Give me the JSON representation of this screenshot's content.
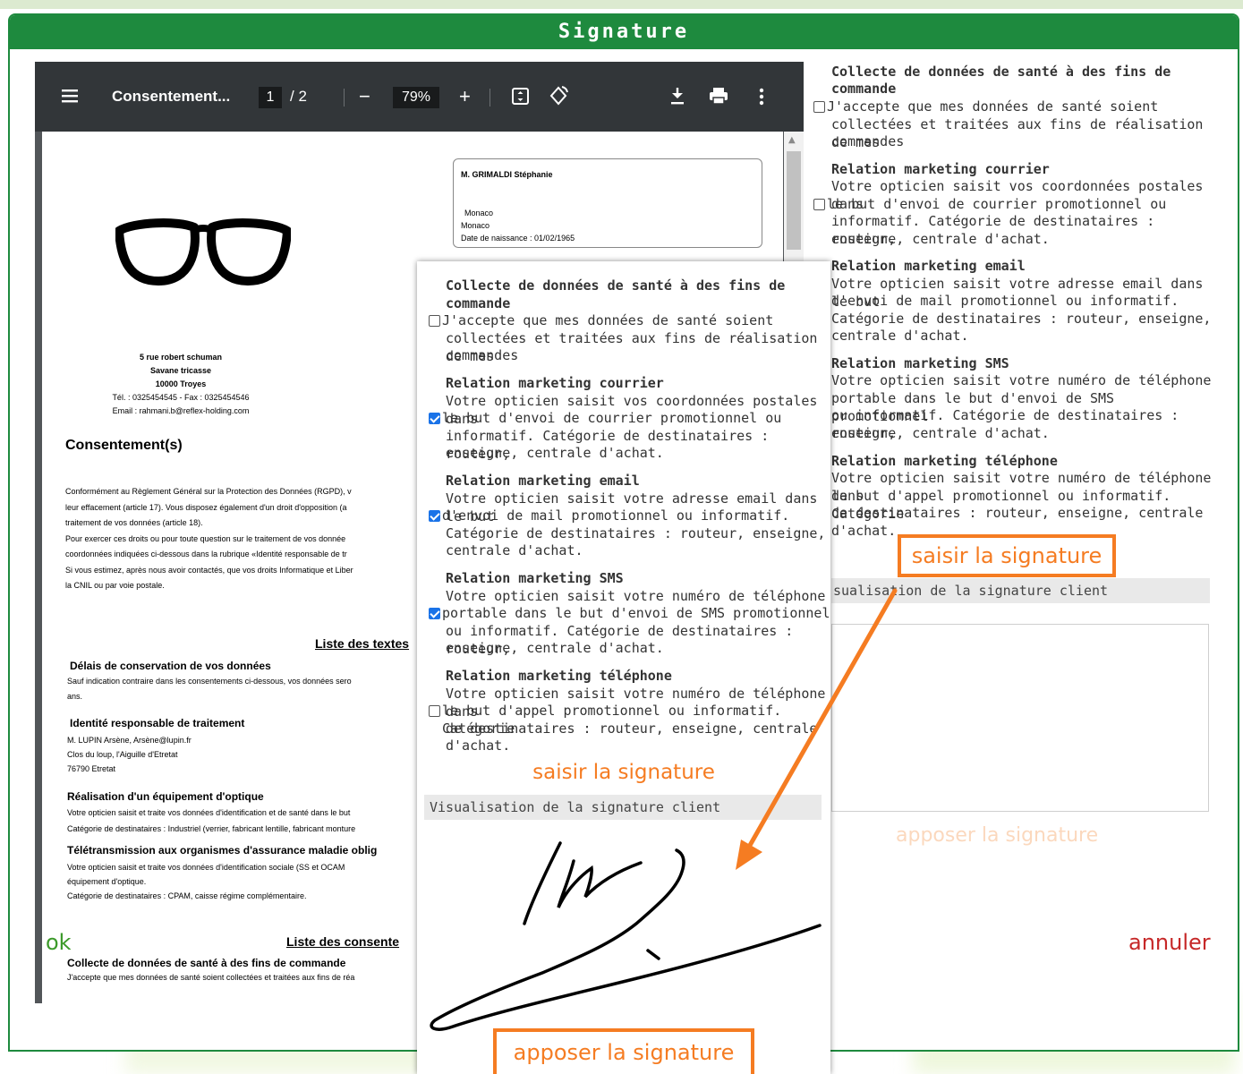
{
  "dialog": {
    "title": "Signature",
    "ok_label": "ok",
    "cancel_label": "annuler"
  },
  "pdf": {
    "toolbar": {
      "menu_icon": "hamburger-icon",
      "doc_title": "Consentement...",
      "page_current": "1",
      "page_total": "/ 2",
      "zoom_out": "−",
      "zoom": "79%",
      "zoom_in": "+",
      "fit_icon": "fit-page-icon",
      "rotate_icon": "rotate-icon",
      "download_icon": "download-icon",
      "print_icon": "print-icon",
      "more_icon": "more-vert-icon"
    },
    "patient": {
      "name": "M. GRIMALDI Stéphanie",
      "city1": "Monaco",
      "city2": "Monaco",
      "birth": "Date de naissance : 01/02/1965"
    },
    "address": {
      "line1": "5 rue robert schuman",
      "line2": "Savane tricasse",
      "line3": "10000 Troyes",
      "phone": "Tél. : 0325454545 - Fax : 0325454546",
      "email": "Email : rahmani.b@reflex-holding.com"
    },
    "consent_heading": "Consentement(s)",
    "body": [
      "Conformément au Règlement Général sur la Protection des Données (RGPD), v",
      "leur effacement (article 17). Vous disposez également d'un droit d'opposition (a",
      "traitement de vos données (article 18).",
      "Pour exercer ces droits ou pour toute question sur le traitement de vos donnée",
      "coordonnées indiquées ci-dessous dans la rubrique «Identité responsable de tr",
      "Si vous estimez, après nous avoir contactés, que vos droits Informatique et Liber",
      "la CNIL ou par voie postale."
    ],
    "list_texts": "Liste des textes",
    "delais_title": "Délais de conservation de vos données",
    "delais_body1": "Sauf indication contraire dans les consentements ci-dessous, vos données sero",
    "delais_body2": "ans.",
    "identite_title": "Identité responsable de traitement",
    "identite_lines": [
      "M. LUPIN Arsène, Arsène@lupin.fr",
      "Clos du loup, l'Aiguille d'Etretat",
      "76790 Etretat"
    ],
    "realisation_title": "Réalisation d'un équipement d'optique",
    "realisation_lines": [
      "Votre opticien saisit et traite vos données d'identification et de santé dans le but",
      "Catégorie de destinataires : Industriel (verrier, fabricant lentille, fabricant monture"
    ],
    "teletrans_title": "Télétransmission aux organismes d'assurance maladie oblig",
    "teletrans_lines": [
      "Votre opticien saisit et traite vos données d'identification sociale (SS et OCAM",
      "équipement d'optique.",
      "Catégorie de destinataires : CPAM, caisse régime complémentaire."
    ],
    "list_consents": "Liste des consente",
    "collecte_title": "Collecte de données de santé à des fins de commande",
    "collecte_body": "J'accepte que mes données de santé soient collectées et traitées aux fins de réa"
  },
  "right": {
    "s1_title1": "Collecte de données de santé à des fins de",
    "s1_title2": "commande",
    "s1_l1": "J'accepte que mes données de santé soient",
    "s1_l2": "collectées et traitées aux fins de réalisation de mes",
    "s1_l3": "commandes",
    "s2_title": "Relation marketing courrier",
    "s2_l1": "Votre opticien saisit vos coordonnées postales dans",
    "s2_l2": "le but d'envoi de courrier promotionnel ou",
    "s2_l3": "informatif. Catégorie de destinataires : routeur,",
    "s2_l4": "enseigne, centrale d'achat.",
    "s3_title": "Relation marketing email",
    "s3_l1": "Votre opticien saisit votre adresse email dans le but",
    "s3_l2": "d'envoi de mail promotionnel ou informatif.",
    "s3_l3": "Catégorie de destinataires : routeur, enseigne,",
    "s3_l4": "centrale d'achat.",
    "s4_title": "Relation marketing SMS",
    "s4_l1": "Votre opticien saisit votre numéro de téléphone",
    "s4_l2": "portable dans le but d'envoi de SMS promotionnel",
    "s4_l3": "ou informatif. Catégorie de destinataires : routeur,",
    "s4_l4": "enseigne, centrale d'achat.",
    "s5_title": "Relation marketing téléphone",
    "s5_l1": "Votre opticien saisit votre numéro de téléphone dans",
    "s5_l2": "le but d'appel promotionnel ou informatif. Catégorie",
    "s5_l3": "de destinataires : routeur, enseigne, centrale",
    "s5_l4": "d'achat.",
    "saisir": "saisir la signature",
    "vis_label": "sualisation de la signature client",
    "apposer": "apposer la signature"
  },
  "popup": {
    "s1_title1": "Collecte de données de santé à des fins de",
    "s1_title2": "commande",
    "s1_l1": "J'accepte que mes données de santé soient",
    "s1_l2": "collectées et traitées aux fins de réalisation de mes",
    "s1_l3": "commandes",
    "s2_title": "Relation marketing courrier",
    "s2_l1": "Votre opticien saisit vos coordonnées postales dans",
    "s2_l2": "le but d'envoi de courrier promotionnel ou",
    "s2_l3": "informatif. Catégorie de destinataires : routeur,",
    "s2_l4": "enseigne, centrale d'achat.",
    "s3_title": "Relation marketing email",
    "s3_l1": "Votre opticien saisit votre adresse email dans le but",
    "s3_l2": "d'envoi de mail promotionnel ou informatif.",
    "s3_l3": "Catégorie de destinataires : routeur, enseigne,",
    "s3_l4": "centrale d'achat.",
    "s4_title": "Relation marketing SMS",
    "s4_l1": "Votre opticien saisit votre numéro de téléphone",
    "s4_l2": "portable dans le but d'envoi de SMS promotionnel",
    "s4_l3": "ou informatif. Catégorie de destinataires : routeur,",
    "s4_l4": "enseigne, centrale d'achat.",
    "s5_title": "Relation marketing téléphone",
    "s5_l1": "Votre opticien saisit votre numéro de téléphone dans",
    "s5_l2": "le but d'appel promotionnel ou informatif. Catégorie",
    "s5_l3": "de destinataires : routeur, enseigne, centrale",
    "s5_l4": "d'achat.",
    "saisir": "saisir la signature",
    "vis_label": "Visualisation de la signature client",
    "apposer": "apposer la signature"
  },
  "colors": {
    "header_green": "#1e8a3e",
    "accent_orange": "#f57c22",
    "checkbox_blue": "#1a73e8",
    "ok_green": "#3c9a2a",
    "cancel_red": "#c62828"
  }
}
